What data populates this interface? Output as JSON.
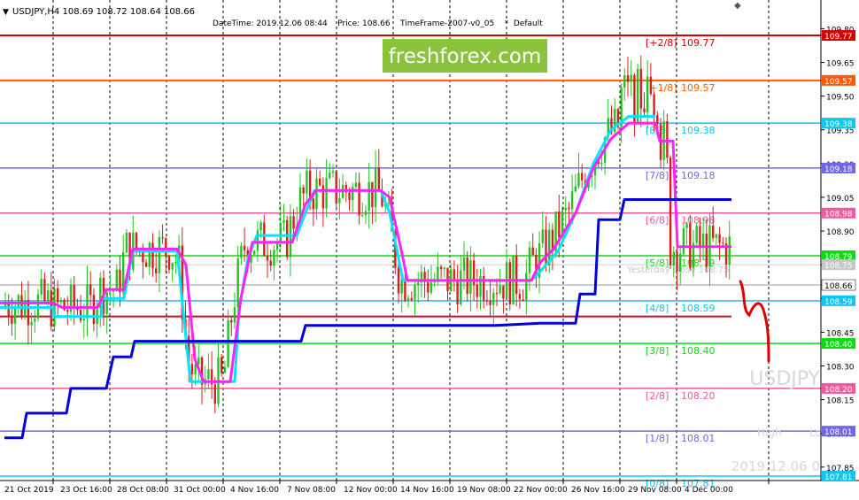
{
  "header": {
    "symbol_line": "USDJPY,H4  108.69 108.72 108.64 108.66",
    "info_line": "DateTime: 2019.12.06 08:44    Price: 108.66    TimeFrame-2007-v0_05    *  Default"
  },
  "watermark": {
    "brand": "freshforex.com",
    "symbol": "USDJPY",
    "date": "2019.12.06 0",
    "high_label": "High",
    "low_label": "Lo"
  },
  "chart_data": {
    "type": "candlestick",
    "symbol": "USDJPY",
    "timeframe": "H4",
    "ohlc_current": {
      "open": 108.69,
      "high": 108.72,
      "low": 108.64,
      "close": 108.66
    },
    "current_price": 108.66,
    "yesterday_close_label": "Yesterday close 108.75",
    "ylim": [
      107.78,
      110.0
    ],
    "y_ticks": [
      109.8,
      109.65,
      109.5,
      109.35,
      109.2,
      109.05,
      108.9,
      108.75,
      108.6,
      108.45,
      108.3,
      108.15,
      108.0,
      107.85
    ],
    "x_ticks": [
      "21 Oct 2019",
      "23 Oct 16:00",
      "28 Oct 08:00",
      "31 Oct 00:00",
      "4 Nov 16:00",
      "7 Nov 08:00",
      "12 Nov 00:00",
      "14 Nov 16:00",
      "19 Nov 08:00",
      "22 Nov 00:00",
      "26 Nov 16:00",
      "29 Nov 08:00",
      "4 Dec 00:00"
    ],
    "bull_color": "#22c422",
    "bear_color": "#d91e1e",
    "murrey_levels": [
      {
        "label": "[+2/8]",
        "value": 109.77,
        "tag": "109.77",
        "color": "#d40000"
      },
      {
        "label": "[+1/8]",
        "value": 109.57,
        "tag": "109.57",
        "color": "#ff5a00"
      },
      {
        "label": "[8/8]",
        "value": 109.38,
        "tag": "109.38",
        "color": "#12c4f0"
      },
      {
        "label": "[7/8]",
        "value": 109.18,
        "tag": "109.18",
        "color": "#7068e0"
      },
      {
        "label": "[6/8]",
        "value": 108.98,
        "tag": "108.98",
        "color": "#f05a9e"
      },
      {
        "label": "[5/8]",
        "value": 108.79,
        "tag": "108.79",
        "color": "#12d812"
      },
      {
        "label": "[4/8]",
        "value": 108.59,
        "tag": "108.59",
        "color": "#12c4f0"
      },
      {
        "label": "[3/8]",
        "value": 108.4,
        "tag": "108.40",
        "color": "#12d812"
      },
      {
        "label": "[2/8]",
        "value": 108.2,
        "tag": "108.20",
        "color": "#f05a9e"
      },
      {
        "label": "[1/8]",
        "value": 108.01,
        "tag": "108.01",
        "color": "#7068e0"
      },
      {
        "label": "[0/8]",
        "value": 107.81,
        "tag": "107.81",
        "color": "#12c4f0"
      }
    ],
    "price_tags": [
      {
        "value": 108.75,
        "tag": "108.75",
        "color": "#c8c8c8",
        "text_color": "#ffffff"
      },
      {
        "value": 108.66,
        "tag": "108.66",
        "color": "#ffffff",
        "text_color": "#000000"
      }
    ],
    "support_level": 108.52,
    "series": [
      {
        "color": "#00e5ff",
        "points": [
          [
            0,
            108.56
          ],
          [
            60,
            108.56
          ],
          [
            60,
            108.52
          ],
          [
            115,
            108.52
          ],
          [
            115,
            108.6
          ],
          [
            140,
            108.6
          ],
          [
            150,
            108.81
          ],
          [
            200,
            108.81
          ],
          [
            215,
            108.23
          ],
          [
            265,
            108.23
          ],
          [
            270,
            108.55
          ],
          [
            280,
            108.78
          ],
          [
            290,
            108.88
          ],
          [
            335,
            108.88
          ],
          [
            355,
            109.08
          ],
          [
            430,
            109.08
          ],
          [
            440,
            108.98
          ],
          [
            455,
            108.68
          ],
          [
            510,
            108.68
          ],
          [
            600,
            108.68
          ],
          [
            610,
            108.72
          ],
          [
            630,
            108.81
          ],
          [
            650,
            108.98
          ],
          [
            670,
            109.2
          ],
          [
            690,
            109.35
          ],
          [
            710,
            109.41
          ],
          [
            740,
            109.41
          ]
        ]
      },
      {
        "color": "#ff22ff",
        "points": [
          [
            0,
            108.58
          ],
          [
            60,
            108.58
          ],
          [
            70,
            108.56
          ],
          [
            110,
            108.56
          ],
          [
            120,
            108.64
          ],
          [
            140,
            108.64
          ],
          [
            150,
            108.82
          ],
          [
            200,
            108.82
          ],
          [
            210,
            108.75
          ],
          [
            220,
            108.33
          ],
          [
            230,
            108.23
          ],
          [
            260,
            108.23
          ],
          [
            272,
            108.6
          ],
          [
            285,
            108.85
          ],
          [
            330,
            108.85
          ],
          [
            345,
            109.02
          ],
          [
            357,
            109.08
          ],
          [
            430,
            109.08
          ],
          [
            440,
            109.05
          ],
          [
            455,
            108.78
          ],
          [
            460,
            108.68
          ],
          [
            600,
            108.68
          ],
          [
            610,
            108.76
          ],
          [
            625,
            108.82
          ],
          [
            650,
            108.98
          ],
          [
            670,
            109.18
          ],
          [
            690,
            109.31
          ],
          [
            710,
            109.38
          ],
          [
            740,
            109.38
          ],
          [
            745,
            109.3
          ],
          [
            760,
            109.3
          ],
          [
            765,
            108.83
          ],
          [
            826,
            108.83
          ]
        ]
      },
      {
        "color": "#0000dc",
        "points": [
          [
            5,
            107.98
          ],
          [
            25,
            107.98
          ],
          [
            30,
            108.09
          ],
          [
            75,
            108.09
          ],
          [
            80,
            108.2
          ],
          [
            120,
            108.2
          ],
          [
            128,
            108.34
          ],
          [
            148,
            108.34
          ],
          [
            152,
            108.41
          ],
          [
            340,
            108.41
          ],
          [
            345,
            108.48
          ],
          [
            535,
            108.48
          ],
          [
            560,
            108.48
          ],
          [
            610,
            108.49
          ],
          [
            650,
            108.49
          ],
          [
            655,
            108.62
          ],
          [
            672,
            108.62
          ],
          [
            676,
            108.95
          ],
          [
            700,
            108.95
          ],
          [
            705,
            109.04
          ],
          [
            826,
            109.04
          ]
        ]
      }
    ],
    "forecast_color": "#dd0000"
  }
}
